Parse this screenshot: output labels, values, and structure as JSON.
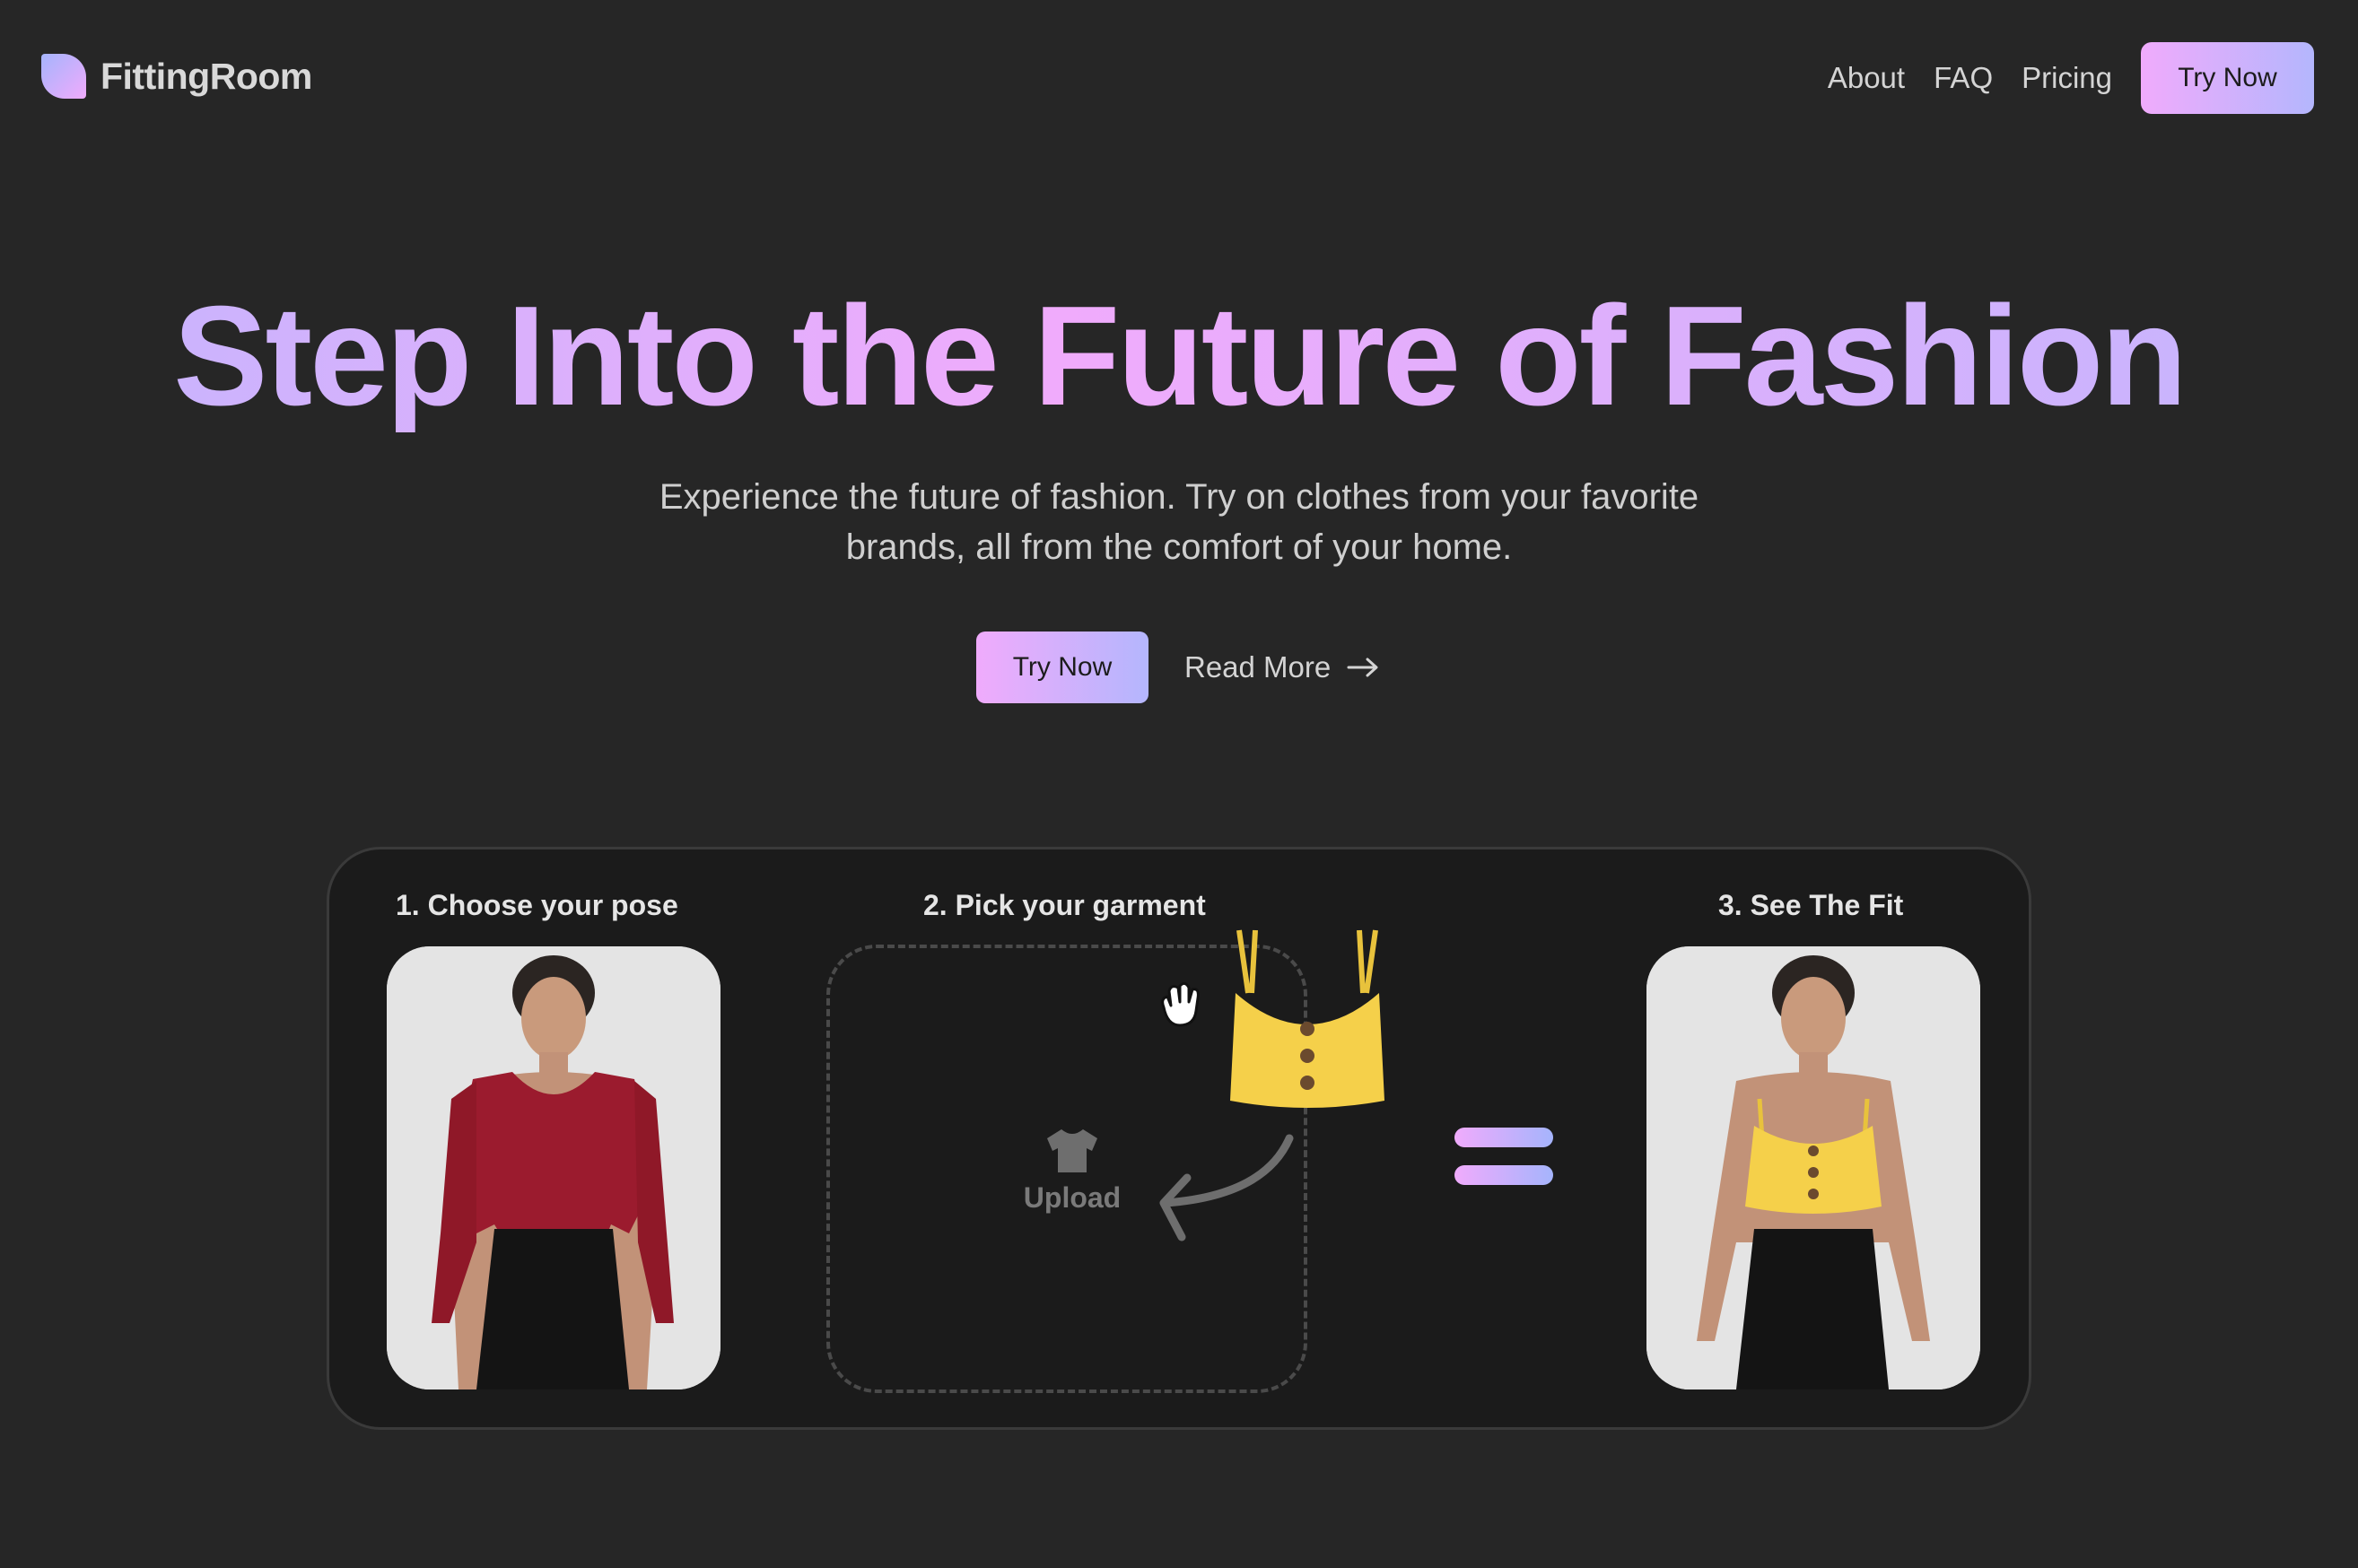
{
  "nav": {
    "brand": "FittingRoom",
    "links": [
      "About",
      "FAQ",
      "Pricing"
    ],
    "cta_label": "Try Now"
  },
  "hero": {
    "title": "Step Into the Future of Fashion",
    "subtitle_line1": "Experience the future of fashion. Try on clothes from your favorite",
    "subtitle_line2": "brands, all from the comfort of your home.",
    "primary_cta": "Try Now",
    "secondary_cta": "Read More"
  },
  "demo": {
    "step1_label": "1. Choose your pose",
    "step2_label": "2. Pick your garment",
    "step3_label": "3. See The Fit",
    "upload_label": "Upload"
  },
  "colors": {
    "background": "#262626",
    "card": "#1b1b1b",
    "accent_pink": "#f0abfc",
    "accent_violet": "#a5b4fc",
    "garment_yellow": "#f5d04a",
    "top_red": "#9b1b2e"
  },
  "icons": [
    "logo-mark-icon",
    "arrow-right-icon",
    "tshirt-icon",
    "grab-hand-icon",
    "curved-arrow-icon",
    "equals-icon"
  ]
}
